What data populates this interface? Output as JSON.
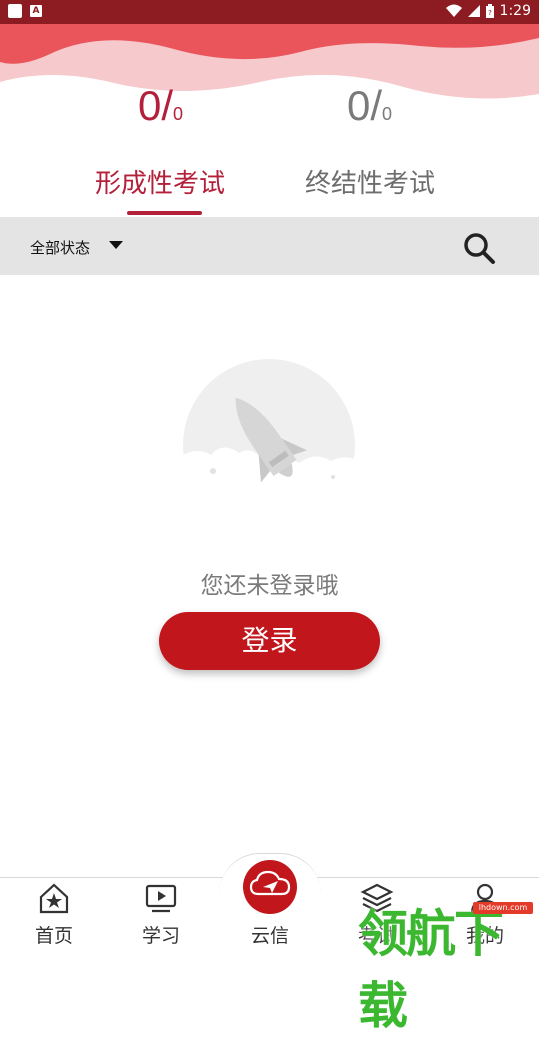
{
  "status_bar": {
    "time": "1:29",
    "notification_badge": "A"
  },
  "tabs": [
    {
      "score_num": "0",
      "score_slash": "/",
      "score_den": "0",
      "label": "形成性考试",
      "active": true
    },
    {
      "score_num": "0",
      "score_slash": "/",
      "score_den": "0",
      "label": "终结性考试",
      "active": false
    }
  ],
  "filter": {
    "label": "全部状态",
    "caret_icon": "caret-down-icon",
    "search_icon": "search-icon"
  },
  "empty_state": {
    "message": "您还未登录哦",
    "login_button": "登录",
    "illustration": "rocket-icon"
  },
  "bottom_nav": [
    {
      "label": "首页",
      "icon": "home-star-icon"
    },
    {
      "label": "学习",
      "icon": "play-video-icon"
    },
    {
      "label": "云信",
      "icon": "cloud-send-icon"
    },
    {
      "label": "考试",
      "icon": "layers-icon"
    },
    {
      "label": "我的",
      "icon": "user-icon"
    }
  ],
  "watermark": {
    "text": "领航下载",
    "url": "lhdown.com"
  },
  "colors": {
    "accent": "#b3203a",
    "primary_button": "#c1161c",
    "status_bar": "#8c1c22"
  }
}
